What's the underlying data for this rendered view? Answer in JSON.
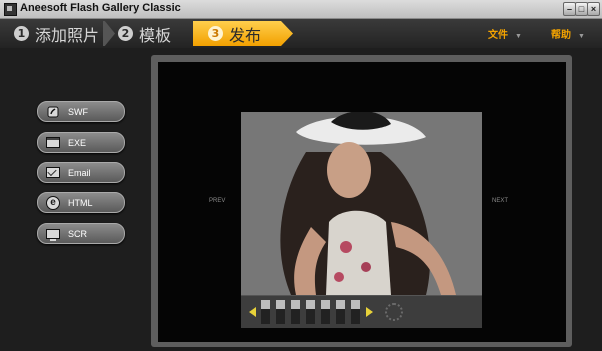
{
  "window": {
    "title": "Aneesoft Flash Gallery Classic"
  },
  "window_buttons": {
    "minimize": "–",
    "maximize": "□",
    "close": "×"
  },
  "steps": [
    {
      "number": "1",
      "label": "添加照片"
    },
    {
      "number": "2",
      "label": "模板"
    },
    {
      "number": "3",
      "label": "发布",
      "active": true
    }
  ],
  "menus": {
    "file": "文件",
    "help": "帮助",
    "caret": "▼"
  },
  "outputs": [
    {
      "label": "SWF",
      "icon": "swf-icon"
    },
    {
      "label": "EXE",
      "icon": "window-icon"
    },
    {
      "label": "Email",
      "icon": "envelope-icon"
    },
    {
      "label": "HTML",
      "icon": "ie-icon"
    },
    {
      "label": "SCR",
      "icon": "monitor-icon"
    }
  ],
  "preview": {
    "prev": "PREV",
    "next": "NEXT",
    "ie_glyph": "e"
  },
  "colors": {
    "accent": "#f4a300",
    "step_active": "#ffc72c",
    "background": "#1e1e1e"
  }
}
